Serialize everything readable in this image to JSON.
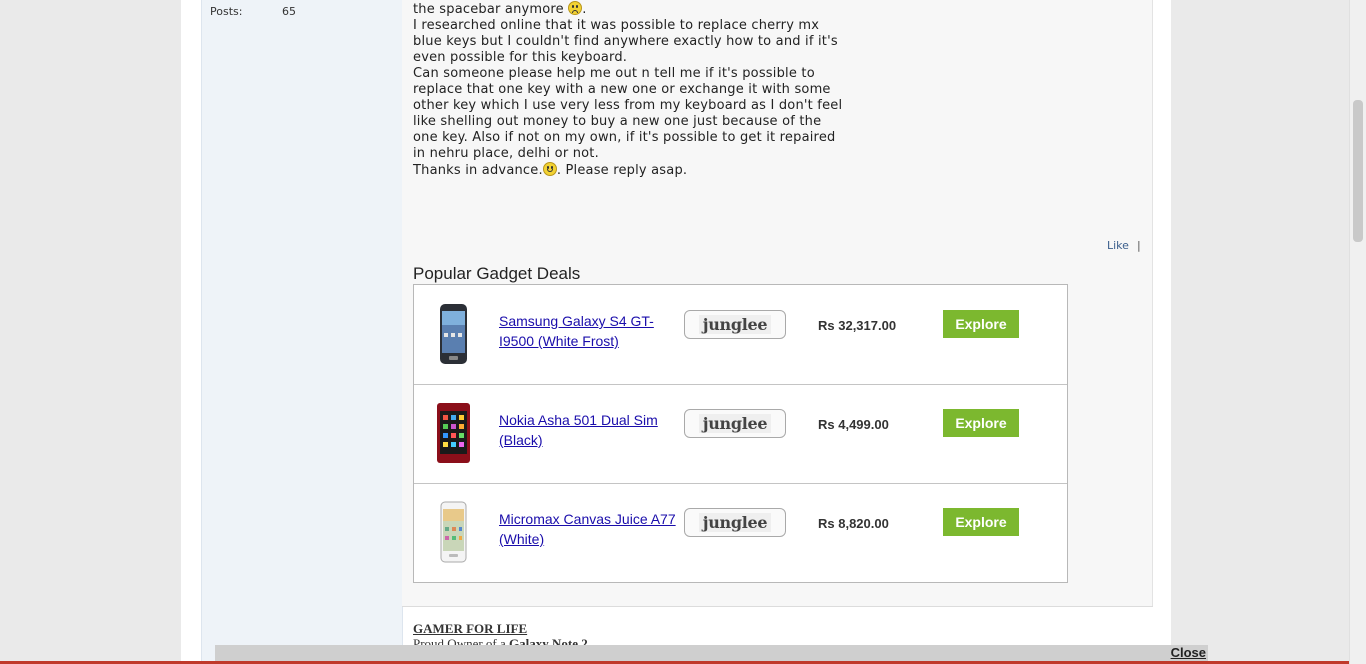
{
  "user_panel": {
    "posts_label": "Posts:",
    "posts_count": "65"
  },
  "message": {
    "lines": [
      "the spacebar anymore",
      "I researched online that it was possible to replace cherry mx",
      "blue keys but I couldn't find anywhere exactly how to and if it's",
      "even possible for this keyboard.",
      "Can someone please help me out n tell me if it's possible to",
      "replace that one key with a new one or exchange it with some",
      "other key which I use very less from my keyboard as I don't feel",
      "like shelling out money to buy a new one just because of the",
      "one key. Also if not on my own, if it's possible to get it repaired",
      "in nehru place, delhi or not.",
      "Thanks in advance.",
      ". Please reply asap."
    ],
    "emoji_sad": "sad-face-emoji",
    "emoji_happy": "smile-face-emoji"
  },
  "actions": {
    "like_label": "Like",
    "separator": "|"
  },
  "deals": {
    "heading": "Popular Gadget Deals",
    "items": [
      {
        "title": "Samsung Galaxy S4 GT-I9500 (White Frost)",
        "store": "junglee",
        "price": "Rs 32,317.00",
        "button": "Explore",
        "thumb_icon": "samsung-phone-icon"
      },
      {
        "title": "Nokia Asha 501 Dual Sim (Black)",
        "store": "junglee",
        "price": "Rs 4,499.00",
        "button": "Explore",
        "thumb_icon": "nokia-phone-icon"
      },
      {
        "title": "Micromax Canvas Juice A77 (White)",
        "store": "junglee",
        "price": "Rs 8,820.00",
        "button": "Explore",
        "thumb_icon": "micromax-phone-icon"
      }
    ]
  },
  "signature": {
    "title": "GAMER FOR LIFE",
    "line_prefix": "Proud Owner of a ",
    "line_bold": "Galaxy Note 2"
  },
  "bottom_bar": {
    "close_label": "Close"
  },
  "colors": {
    "accent_green": "#7cb82f",
    "link_blue": "#1a0dab",
    "panel_blue": "#eef3f8"
  }
}
